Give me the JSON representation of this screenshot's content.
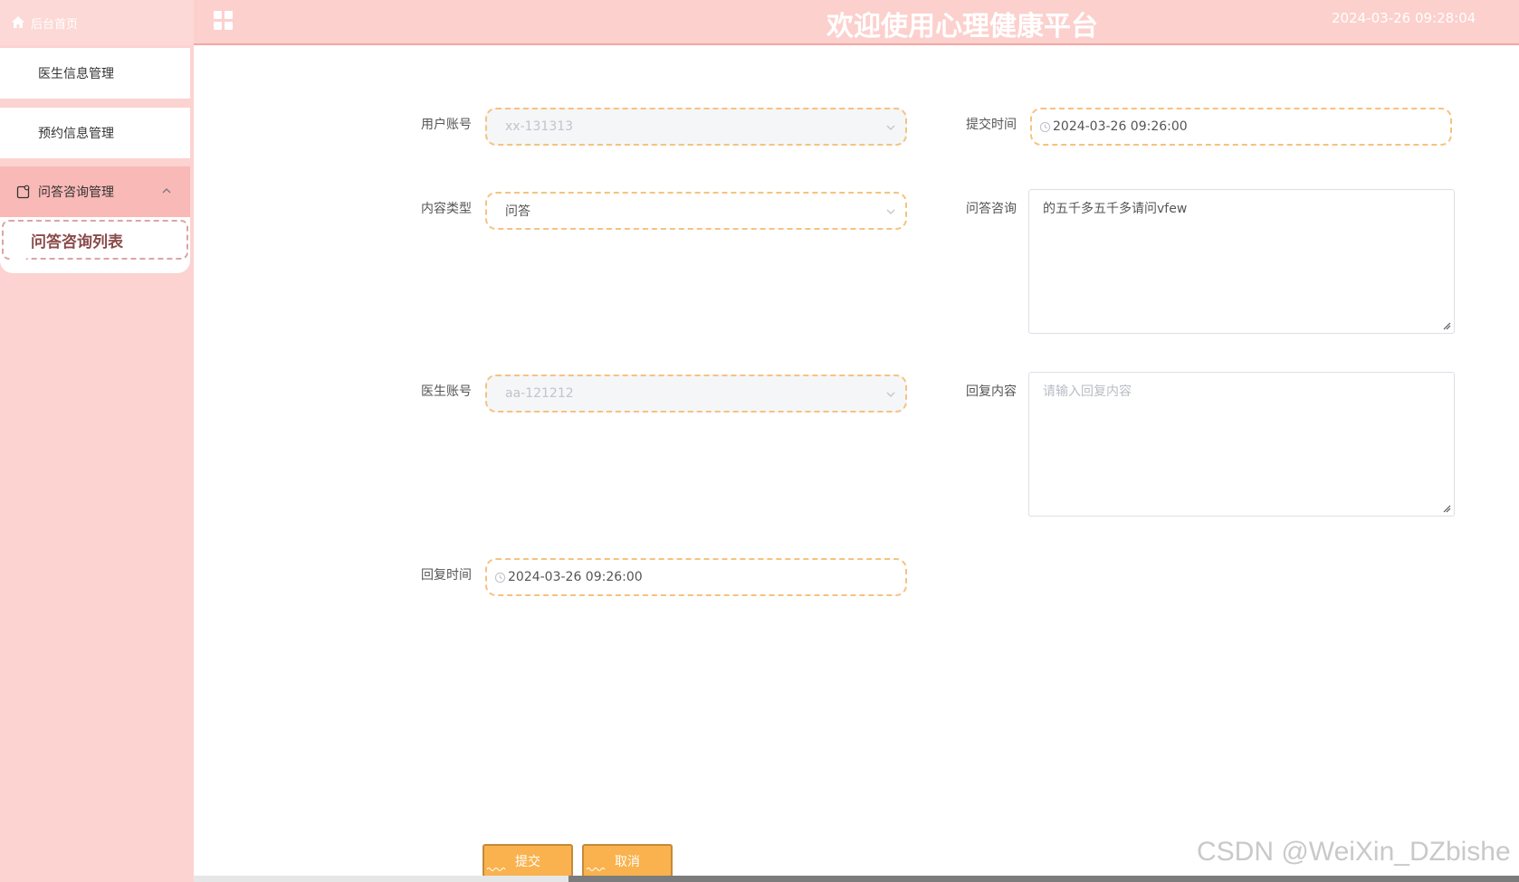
{
  "sidebar": {
    "home_label": "后台首页",
    "items": [
      {
        "label": "医生信息管理"
      },
      {
        "label": "预约信息管理"
      }
    ],
    "group": {
      "label": "问答咨询管理",
      "sub_label": "问答咨询列表"
    }
  },
  "header": {
    "title": "欢迎使用心理健康平台",
    "datetime": "2024-03-26 09:28:04"
  },
  "form": {
    "user_account": {
      "label": "用户账号",
      "value": "xx-131313"
    },
    "submit_time": {
      "label": "提交时间",
      "value": "2024-03-26 09:26:00"
    },
    "content_type": {
      "label": "内容类型",
      "value": "问答"
    },
    "question": {
      "label": "问答咨询",
      "value": "的五千多五千多请问vfew"
    },
    "doctor_account": {
      "label": "医生账号",
      "value": "aa-121212"
    },
    "reply": {
      "label": "回复内容",
      "placeholder": "请输入回复内容"
    },
    "reply_time": {
      "label": "回复时间",
      "value": "2024-03-26 09:26:00"
    }
  },
  "buttons": {
    "submit": "提交",
    "cancel": "取消"
  },
  "watermark": "CSDN @WeiXin_DZbishe",
  "colors": {
    "sidebar_bg": "#fcd3d1",
    "header_bg": "#fcd0cd",
    "accent_button": "#f9b24e",
    "dashed_border": "#f6c27f"
  }
}
